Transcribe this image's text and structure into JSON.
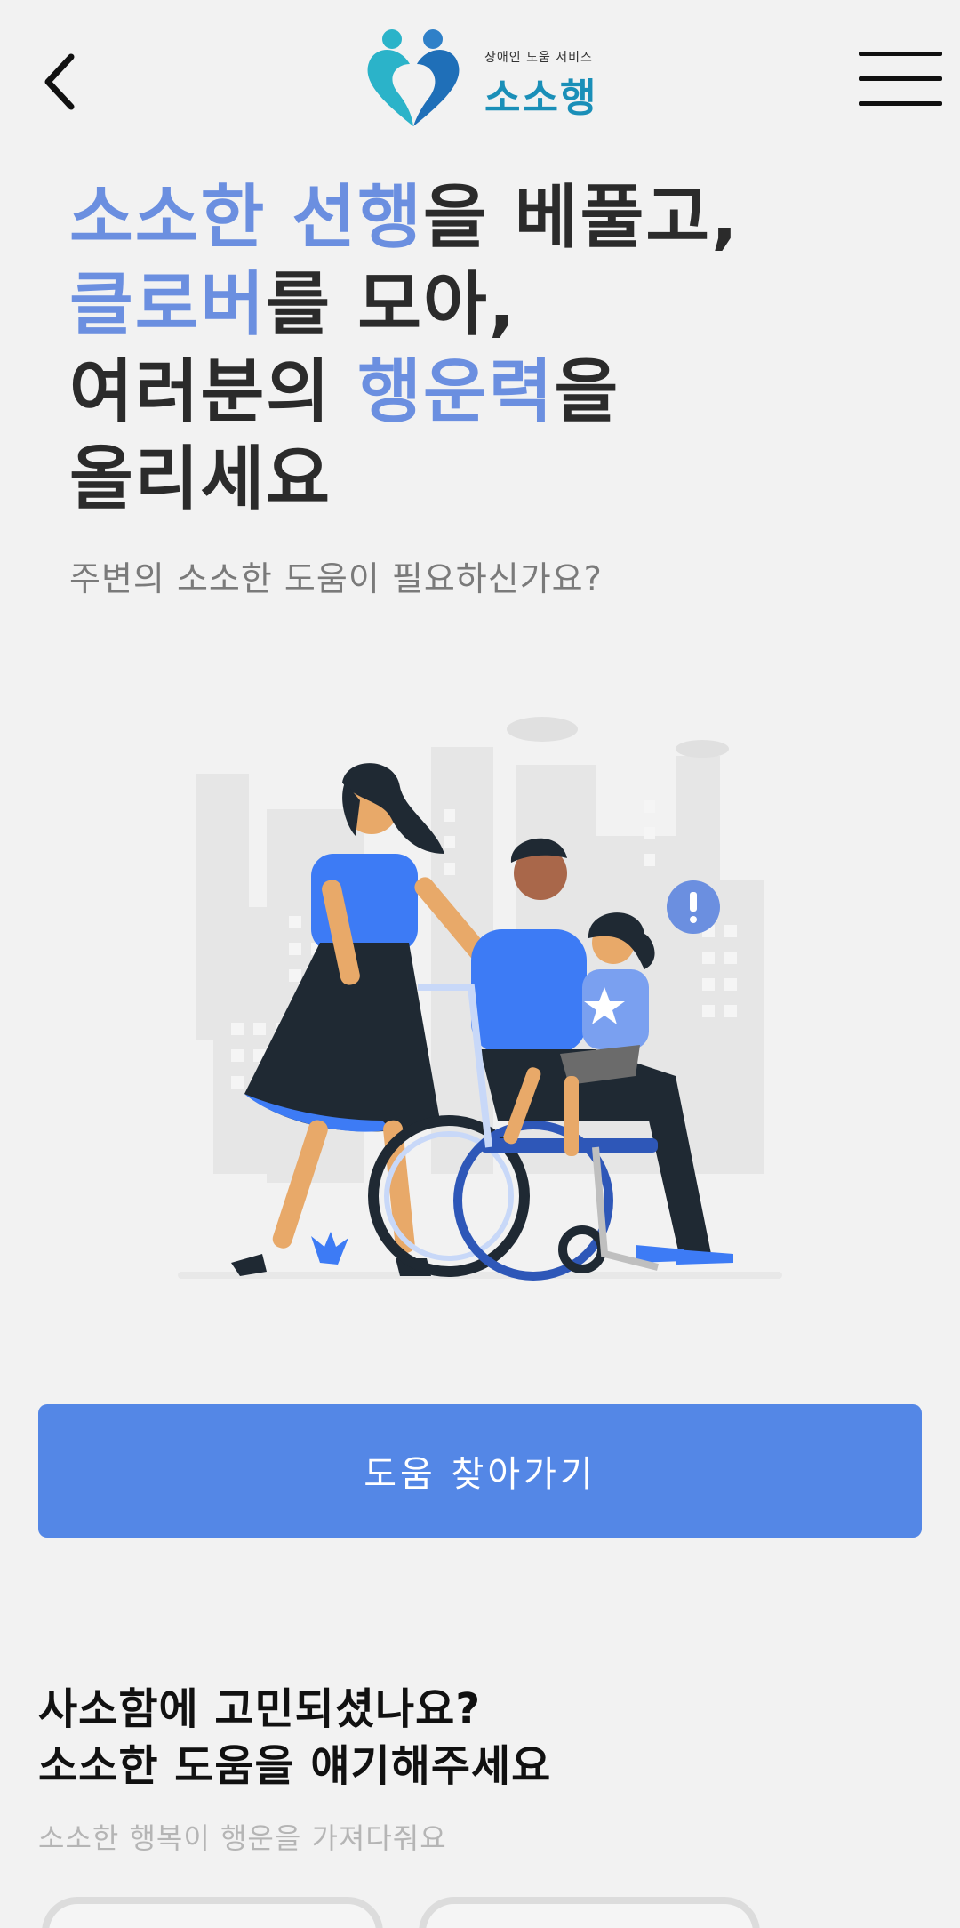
{
  "header": {
    "back_icon": "chevron-left-icon",
    "logo_subtitle": "장애인 도움 서비스",
    "logo_title": "소소행",
    "menu_icon": "hamburger-menu-icon"
  },
  "hero": {
    "line1_hl": "소소한 선행",
    "line1_rest": "을 베풀고,",
    "line2_hl": "클로버",
    "line2_rest": "를 모아,",
    "line3_pre": "여러분의 ",
    "line3_hl": "행운력",
    "line3_rest": "을",
    "line4": "올리세요",
    "subtitle": "주변의 소소한 도움이 필요하신가요?"
  },
  "cta": {
    "label": "도움 찾아가기"
  },
  "section2": {
    "title_line1": "사소함에 고민되셨나요?",
    "title_line2": "소소한 도움을 얘기해주세요",
    "subtitle": "소소한 행복이 행운을 가져다줘요"
  },
  "colors": {
    "accent": "#6b8fe0",
    "button": "#5487e6",
    "logo": "#1a8fb8"
  }
}
